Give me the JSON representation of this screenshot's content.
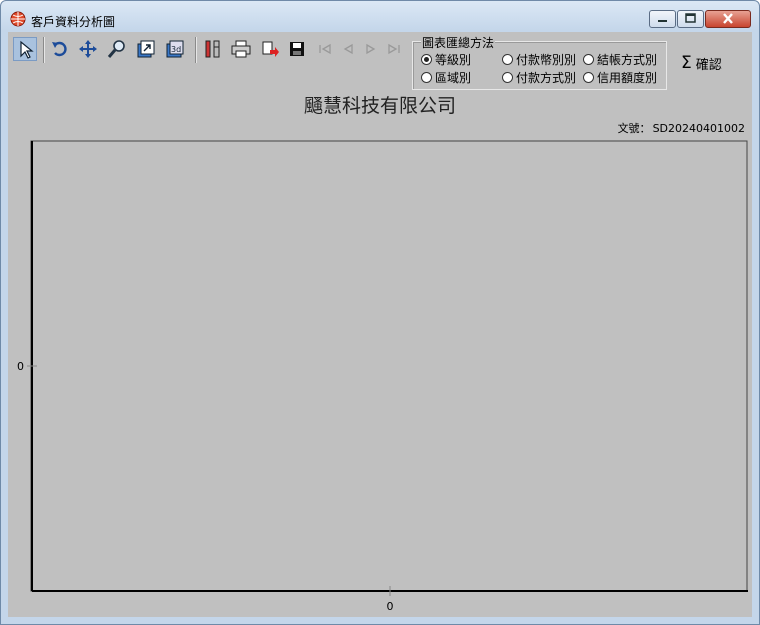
{
  "window": {
    "title": "客戶資料分析圖"
  },
  "toolbar": {
    "items": [
      "pointer-icon",
      "rotate-icon",
      "move-icon",
      "zoom-icon",
      "export-icon",
      "3d-icon",
      "tools-icon",
      "print-icon",
      "copy-icon",
      "save-icon",
      "first-icon",
      "prev-icon",
      "next-icon",
      "last-icon"
    ]
  },
  "group": {
    "title": "圖表匯總方法",
    "options": [
      {
        "label": "等級別",
        "checked": true
      },
      {
        "label": "付款幣別別",
        "checked": false
      },
      {
        "label": "結帳方式別",
        "checked": false
      },
      {
        "label": "區域別",
        "checked": false
      },
      {
        "label": "付款方式別",
        "checked": false
      },
      {
        "label": "信用額度別",
        "checked": false
      }
    ]
  },
  "confirm": {
    "symbol": "Σ",
    "label": "確認"
  },
  "report": {
    "company": "颾慧科技有限公司",
    "doc_label": "文號：",
    "doc_no": "SD20240401002"
  },
  "chart_data": {
    "type": "bar",
    "categories": [],
    "values": [],
    "x_tick": "0",
    "y_tick": "0",
    "title": "",
    "xlabel": "",
    "ylabel": ""
  },
  "colors": {
    "client": "#c0c0c0",
    "axis": "#000000"
  }
}
